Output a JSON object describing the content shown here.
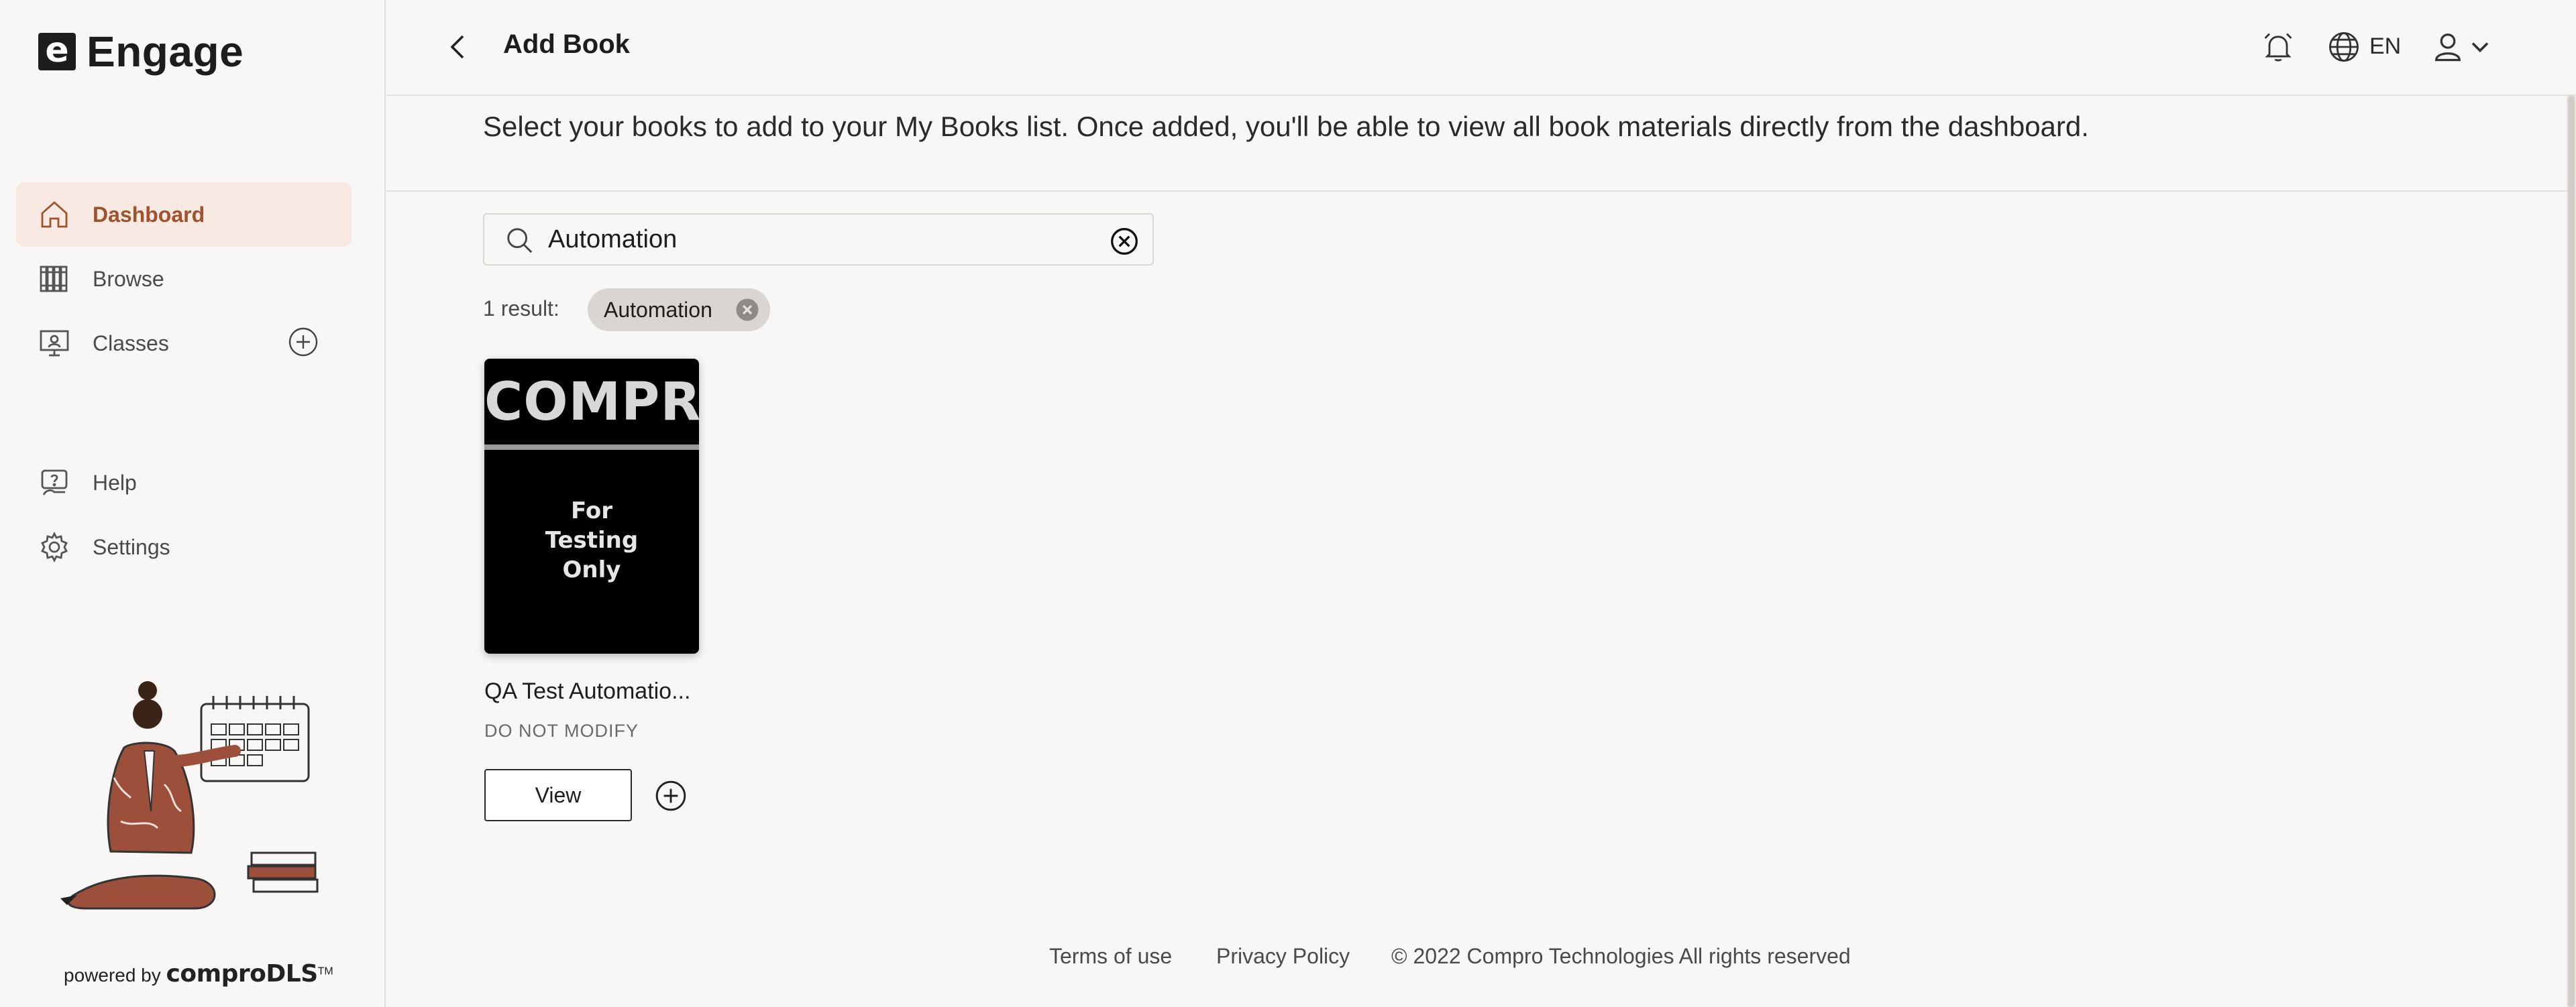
{
  "brand": {
    "mark": "e",
    "name": "Engage"
  },
  "sidebar": {
    "items": [
      {
        "label": "Dashboard",
        "icon": "home-icon",
        "active": true
      },
      {
        "label": "Browse",
        "icon": "books-icon"
      },
      {
        "label": "Classes",
        "icon": "classroom-icon"
      },
      {
        "label": "Help",
        "icon": "help-icon"
      },
      {
        "label": "Settings",
        "icon": "gear-icon"
      }
    ],
    "powered_prefix": "powered by",
    "powered_brand": "comproDLS",
    "powered_tm": "TM"
  },
  "header": {
    "title": "Add Book",
    "language": "EN"
  },
  "main": {
    "instructions": "Select your books to add to your My Books list. Once added, you'll be able to view all book materials directly from the dashboard.",
    "search": {
      "value": "Automation",
      "placeholder": ""
    },
    "result_count": "1 result:",
    "filter_chip": "Automation",
    "books": [
      {
        "cover_brand": "COMPRO",
        "cover_text": "For\nTesting\nOnly",
        "title": "QA Test Automatio...",
        "subtitle": "DO NOT MODIFY",
        "view_label": "View"
      }
    ]
  },
  "footer": {
    "terms": "Terms of use",
    "privacy": "Privacy Policy",
    "copyright": "© 2022 Compro Technologies All rights reserved"
  },
  "colors": {
    "accent": "#a0522d",
    "active_bg": "#f8e9e3",
    "background": "#f9f7f5"
  }
}
